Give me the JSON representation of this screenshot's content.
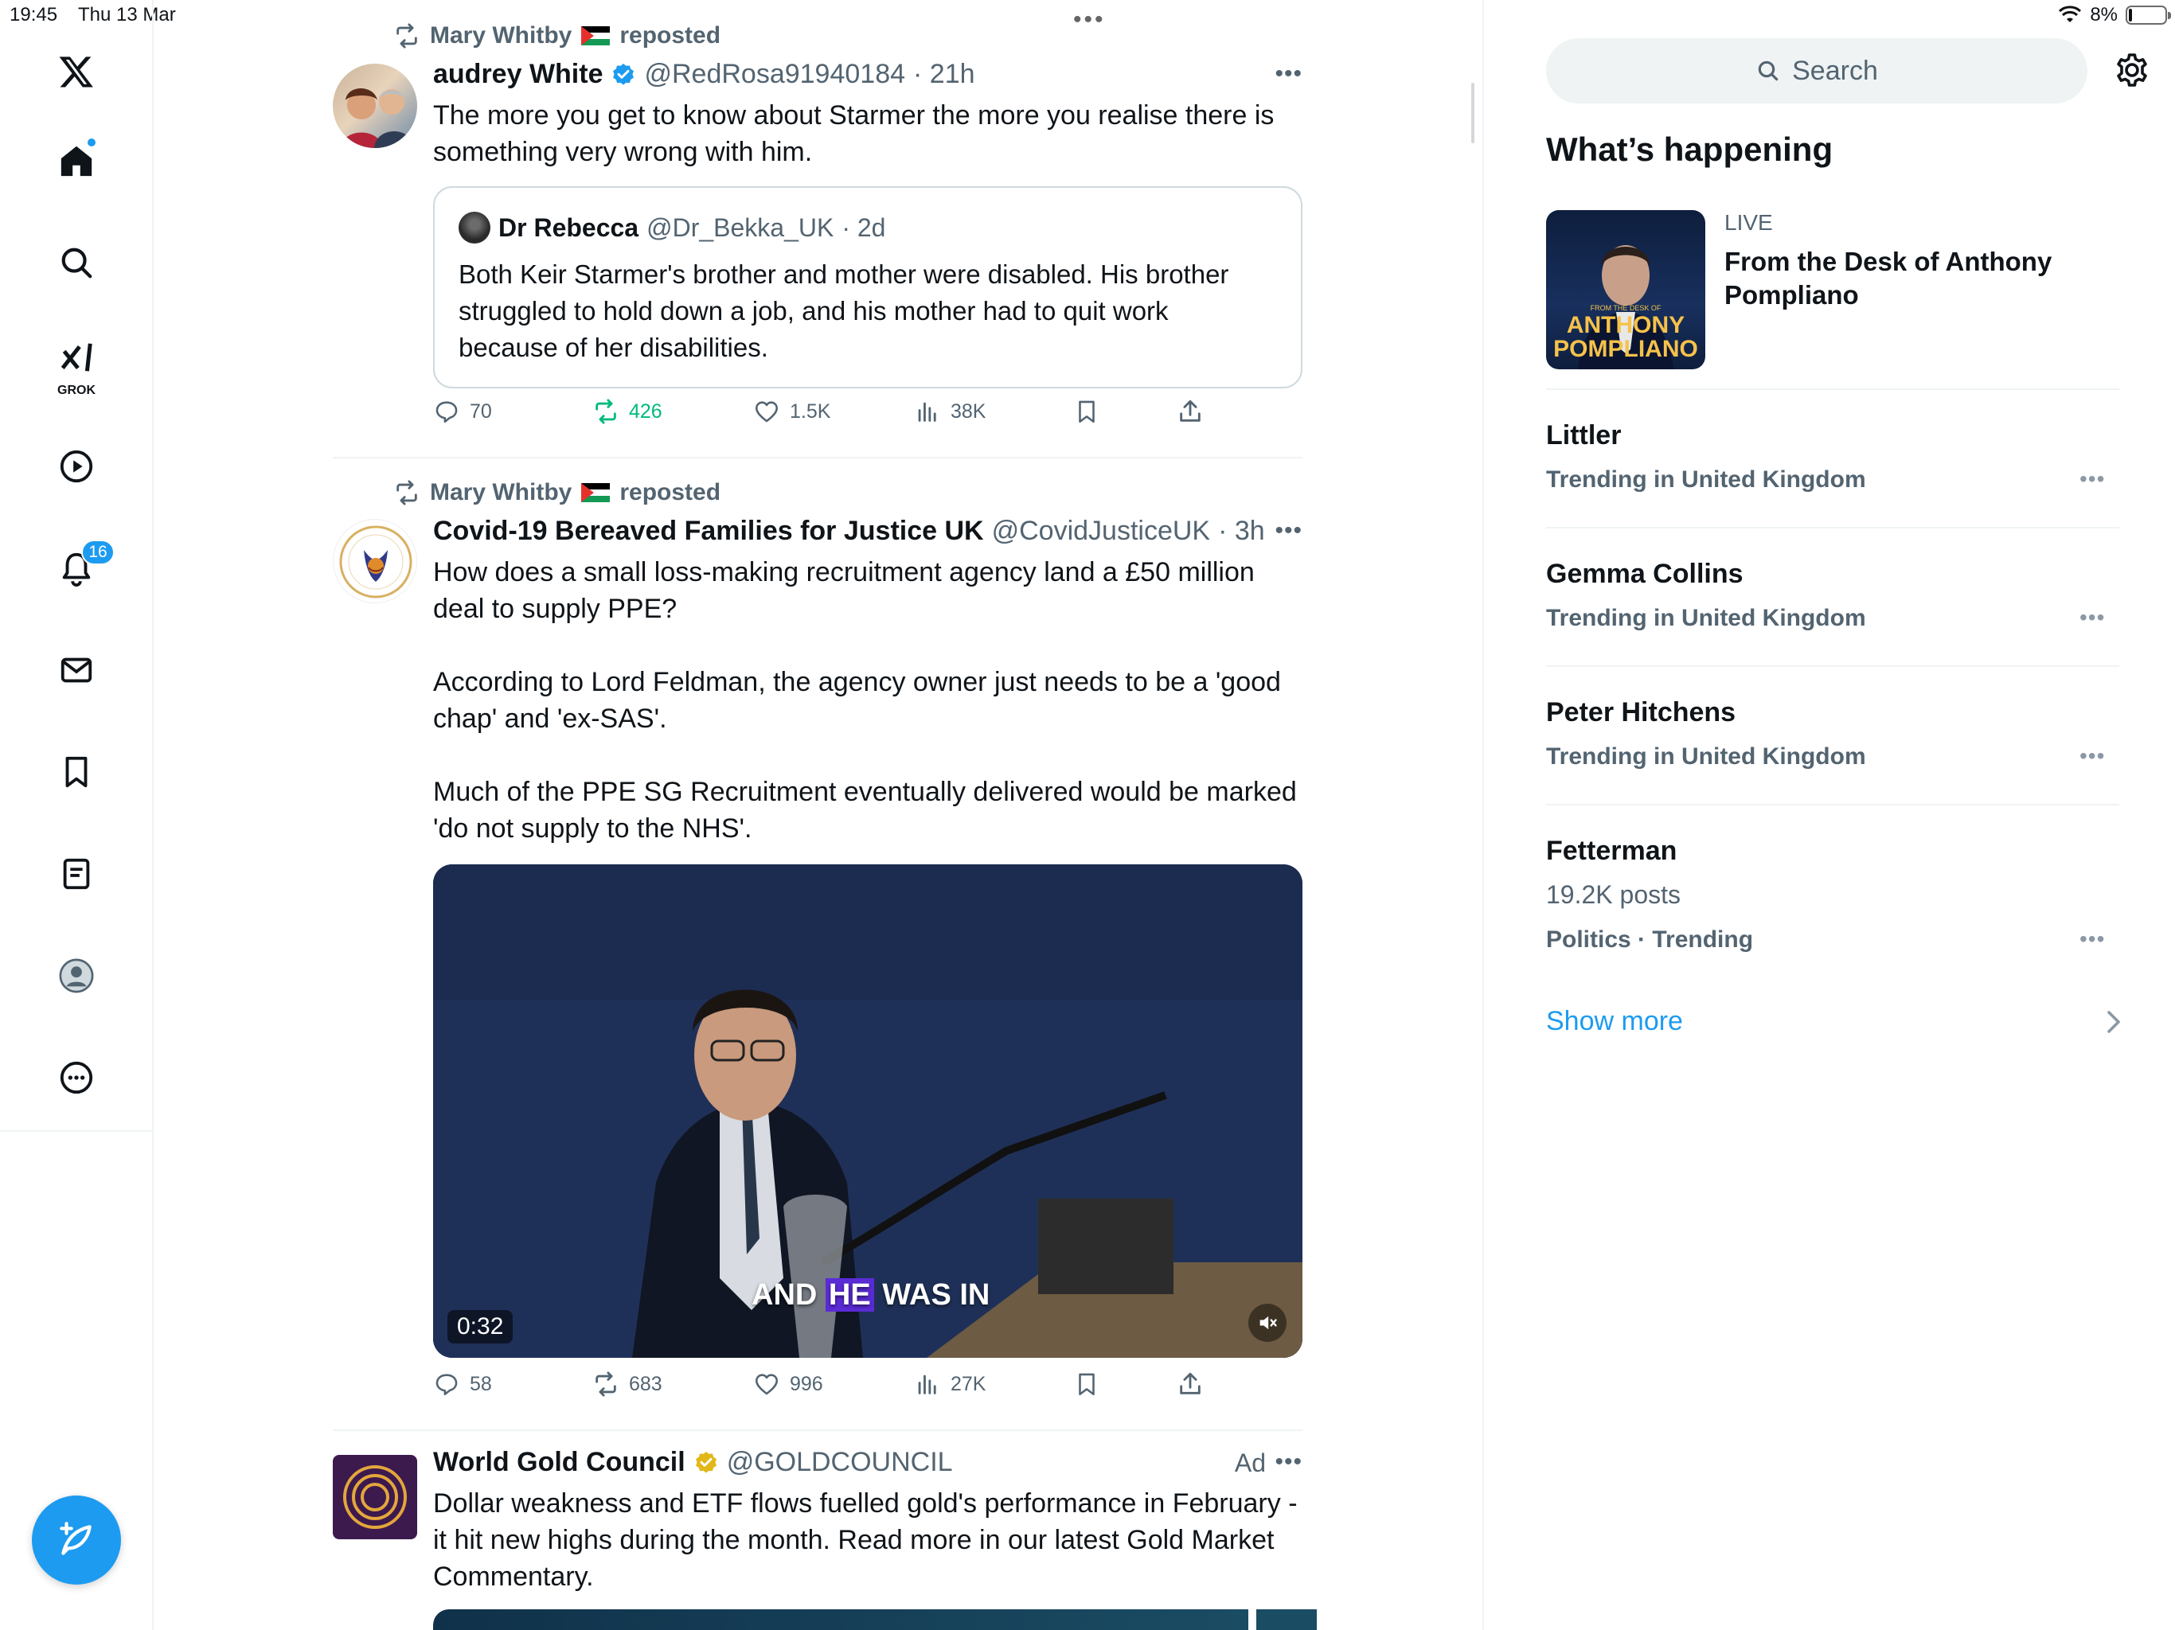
{
  "status_bar": {
    "time": "19:45",
    "date": "Thu 13 Mar",
    "battery": "8%",
    "battery_level": 0.08
  },
  "nav": {
    "items": [
      "x-logo",
      "home",
      "explore",
      "grok",
      "videos",
      "notifications",
      "messages",
      "bookmarks",
      "lists",
      "profile",
      "more"
    ],
    "grok_label": "GROK",
    "notifications_badge": "16"
  },
  "feed": {
    "posts": [
      {
        "repost_by": "Mary Whitby",
        "repost_suffix": "reposted",
        "name": "audrey White",
        "handle": "@RedRosa91940184",
        "time": "· 21h",
        "text": [
          "The more you get to know about Starmer the more you realise there is",
          "something very wrong with him."
        ],
        "quote": {
          "name": "Dr Rebecca",
          "handle": "@Dr_Bekka_UK",
          "time": "· 2d",
          "text": [
            "Both Keir Starmer's brother and mother were disabled. His brother",
            "struggled to hold down a job, and his mother had to quit work",
            "because of her disabilities."
          ]
        },
        "stats": {
          "replies": "70",
          "reposts": "426",
          "likes": "1.5K",
          "views": "38K"
        }
      },
      {
        "repost_by": "Mary Whitby",
        "repost_suffix": "reposted",
        "name": "Covid-19 Bereaved Families for Justice UK",
        "handle": "@CovidJusticeUK",
        "time": "· 3h",
        "text": [
          "How does a small loss-making recruitment agency land a £50 million",
          "deal to supply PPE?",
          "",
          "According to Lord Feldman, the agency owner just needs to be a 'good",
          "chap' and 'ex-SAS'.",
          "",
          "Much of the PPE SG Recruitment eventually delivered would be marked",
          "'do not supply to the NHS'."
        ],
        "video": {
          "duration": "0:32",
          "caption_1": "AND ",
          "caption_highlight": "HE",
          "caption_2": " WAS IN"
        },
        "stats": {
          "replies": "58",
          "reposts": "683",
          "likes": "996",
          "views": "27K"
        }
      },
      {
        "name": "World Gold Council",
        "handle": "@GOLDCOUNCIL",
        "ad_label": "Ad",
        "text": [
          "Dollar weakness and ETF flows fuelled gold's performance in February -",
          "it hit new highs during the month. Read more in our latest Gold Market",
          "Commentary."
        ]
      }
    ]
  },
  "sidebar": {
    "search_placeholder": "Search",
    "section_title": "What’s happening",
    "live": {
      "label": "LIVE",
      "title": "From the Desk of Anthony Pompliano",
      "thumb_small": "FROM THE DESK OF",
      "thumb_line1": "ANTHONY",
      "thumb_line2": "POMPLIANO"
    },
    "trends": [
      {
        "title": "Littler",
        "sub": "Trending in United Kingdom"
      },
      {
        "title": "Gemma Collins",
        "sub": "Trending in United Kingdom"
      },
      {
        "title": "Peter Hitchens",
        "sub": "Trending in United Kingdom"
      },
      {
        "title": "Fetterman",
        "posts": "19.2K posts",
        "sub": "Politics · Trending"
      }
    ],
    "show_more": "Show more"
  },
  "colors": {
    "accent": "#1d9bf0",
    "repost_green": "#00ba7c",
    "secondary_text": "#536471",
    "border": "#eff3f4"
  }
}
